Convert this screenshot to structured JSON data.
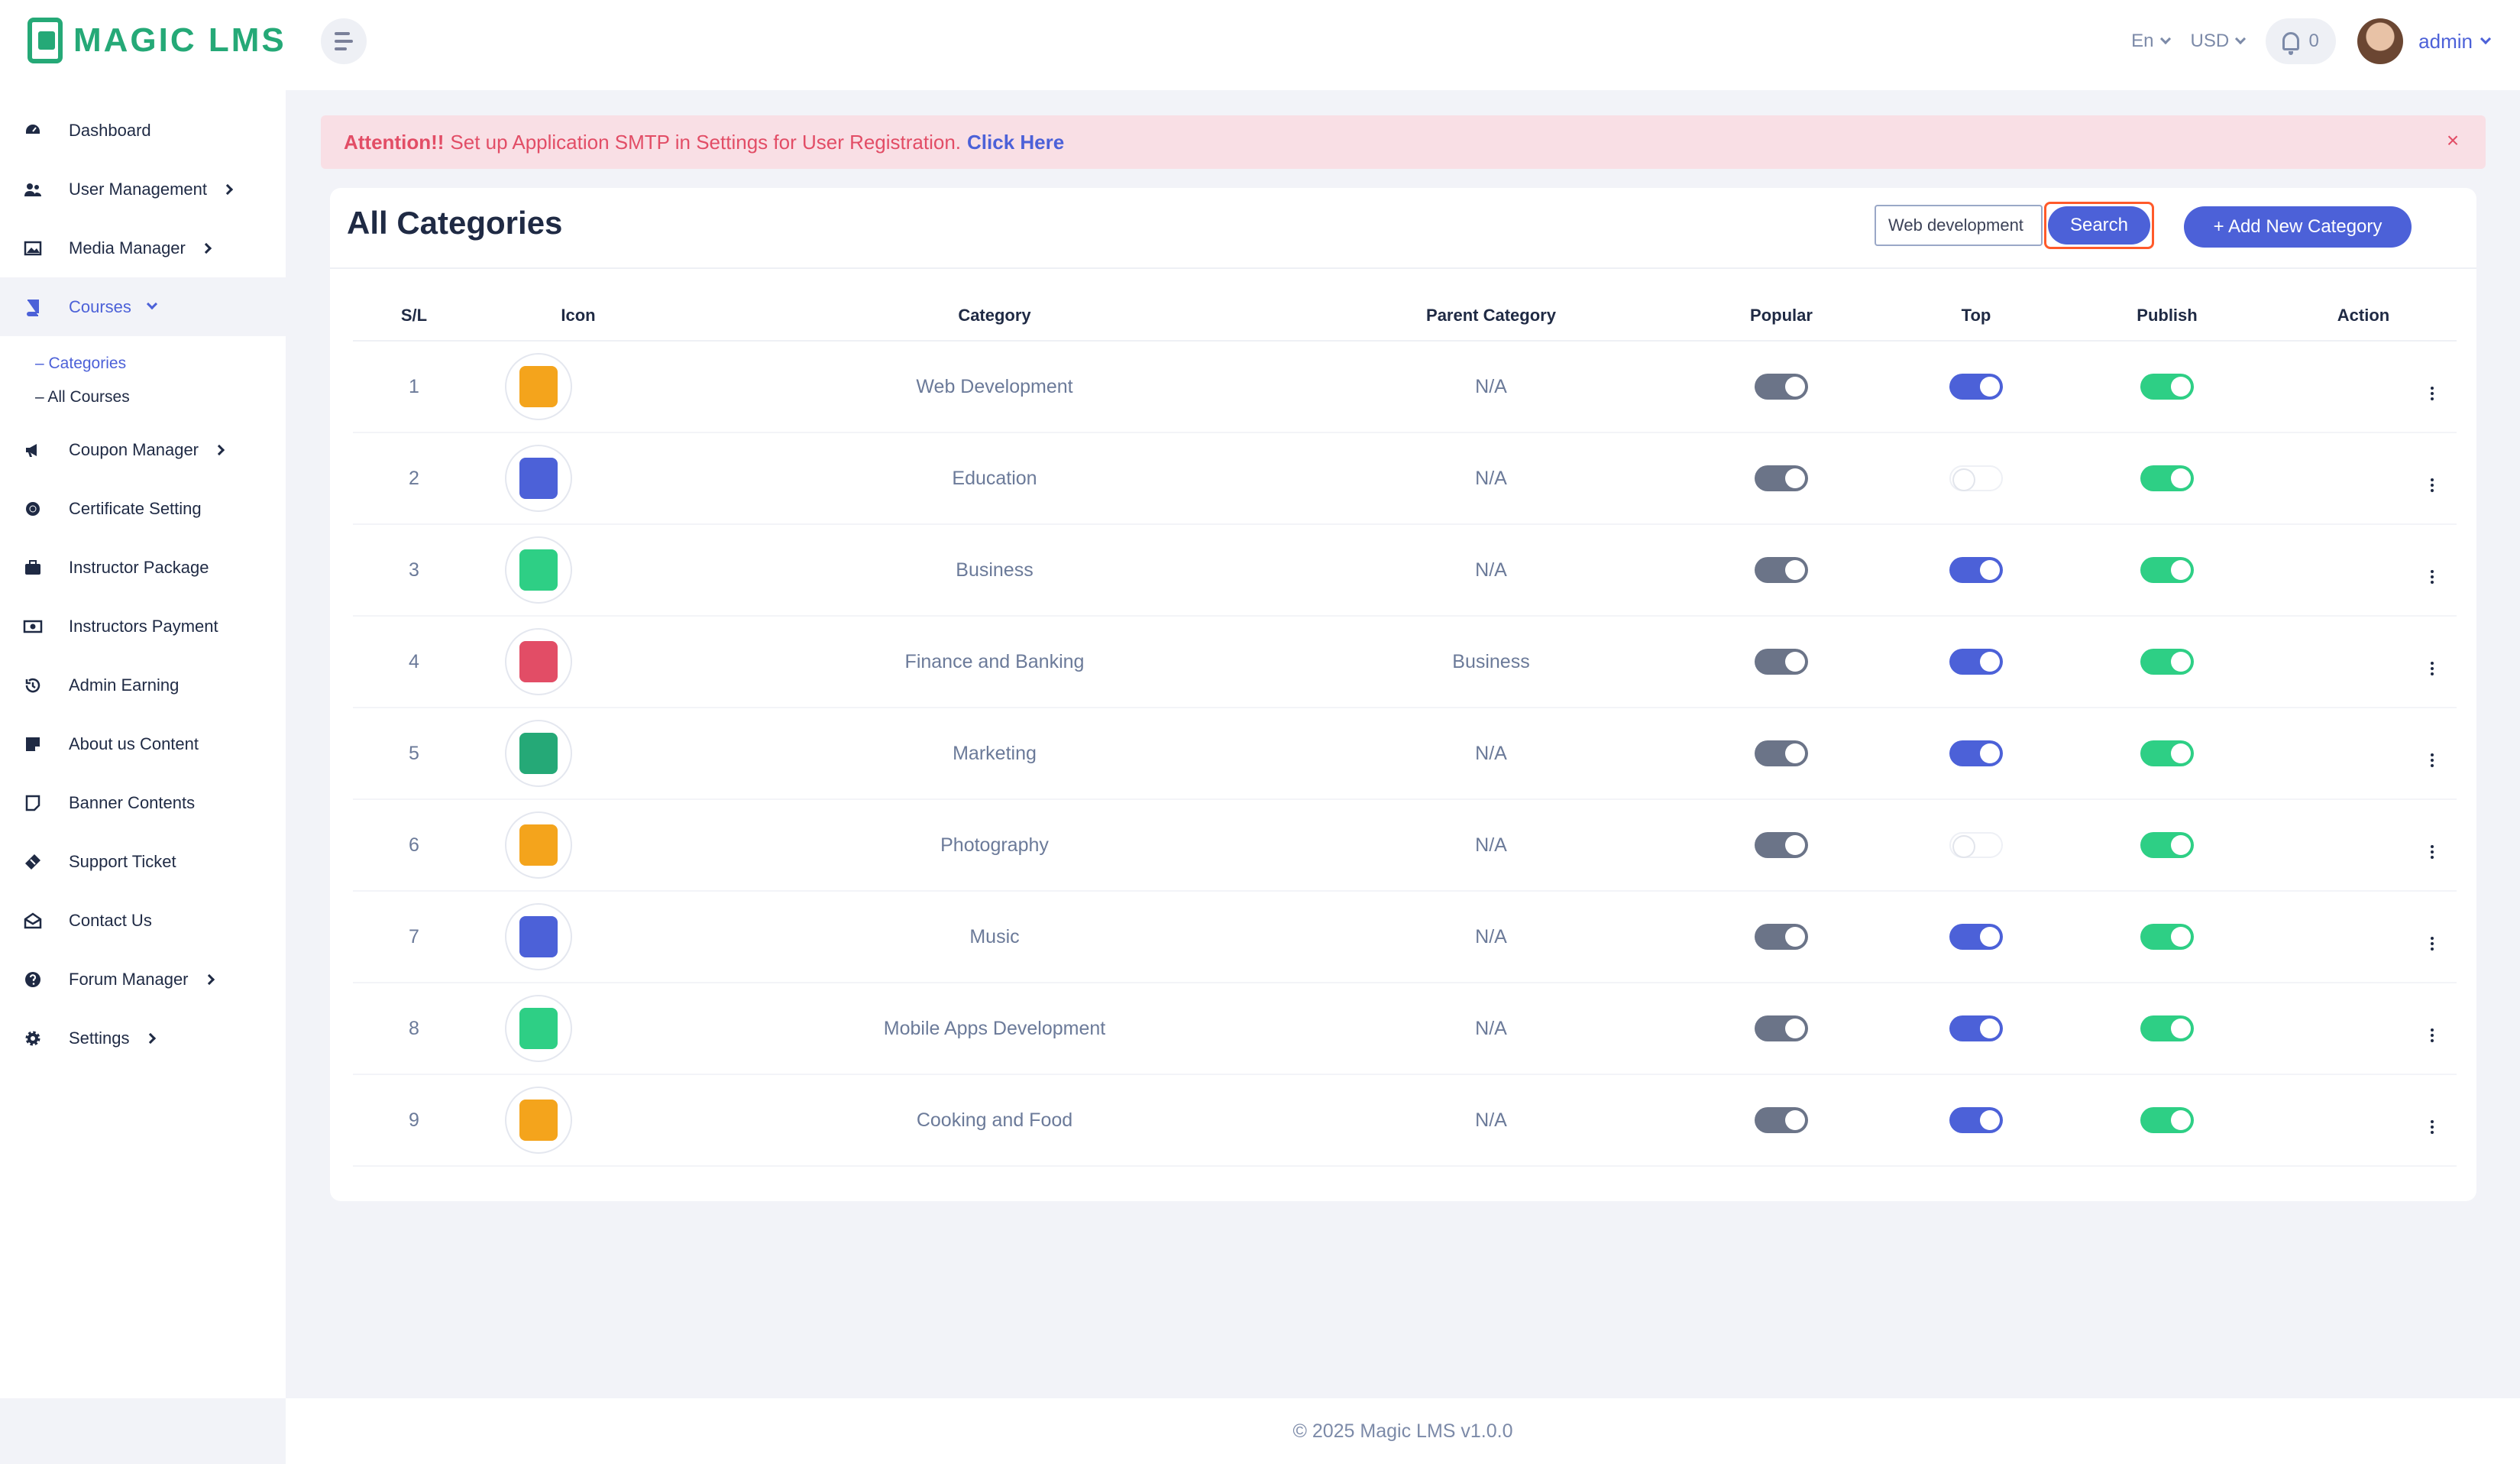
{
  "brand": {
    "name": "MAGIC LMS",
    "color": "#25a977"
  },
  "header": {
    "language": "En",
    "currency": "USD",
    "notification_count": "0",
    "user": "admin"
  },
  "sidebar": {
    "items": [
      {
        "label": "Dashboard",
        "icon": "dashboard-icon"
      },
      {
        "label": "User Management",
        "icon": "users-icon"
      },
      {
        "label": "Media Manager",
        "icon": "image-icon"
      },
      {
        "label": "Courses",
        "icon": "book-icon"
      },
      {
        "label": "Coupon Manager",
        "icon": "megaphone-icon"
      },
      {
        "label": "Certificate Setting",
        "icon": "certificate-icon"
      },
      {
        "label": "Instructor Package",
        "icon": "briefcase-icon"
      },
      {
        "label": "Instructors Payment",
        "icon": "money-icon"
      },
      {
        "label": "Admin Earning",
        "icon": "history-icon"
      },
      {
        "label": "About us Content",
        "icon": "note-icon"
      },
      {
        "label": "Banner Contents",
        "icon": "banner-icon"
      },
      {
        "label": "Support Ticket",
        "icon": "ticket-icon"
      },
      {
        "label": "Contact Us",
        "icon": "envelope-icon"
      },
      {
        "label": "Forum Manager",
        "icon": "question-icon"
      },
      {
        "label": "Settings",
        "icon": "gear-icon"
      }
    ],
    "courses_sub": [
      "– Categories",
      "– All Courses"
    ]
  },
  "alert": {
    "prefix": "Attention!!",
    "message": "Set up Application SMTP in Settings for User Registration.",
    "link": "Click Here"
  },
  "page": {
    "title": "All Categories",
    "search_value": "Web development",
    "search_label": "Search",
    "add_label": "+ Add New Category"
  },
  "table": {
    "headers": [
      "S/L",
      "Icon",
      "Category",
      "Parent Category",
      "Popular",
      "Top",
      "Publish",
      "Action"
    ],
    "rows": [
      {
        "sl": "1",
        "category": "Web Development",
        "parent": "N/A",
        "popular": true,
        "top": true,
        "publish": true
      },
      {
        "sl": "2",
        "category": "Education",
        "parent": "N/A",
        "popular": true,
        "top": false,
        "publish": true
      },
      {
        "sl": "3",
        "category": "Business",
        "parent": "N/A",
        "popular": true,
        "top": true,
        "publish": true
      },
      {
        "sl": "4",
        "category": "Finance and Banking",
        "parent": "Business",
        "popular": true,
        "top": true,
        "publish": true
      },
      {
        "sl": "5",
        "category": "Marketing",
        "parent": "N/A",
        "popular": true,
        "top": true,
        "publish": true
      },
      {
        "sl": "6",
        "category": "Photography",
        "parent": "N/A",
        "popular": true,
        "top": false,
        "publish": true
      },
      {
        "sl": "7",
        "category": "Music",
        "parent": "N/A",
        "popular": true,
        "top": true,
        "publish": true
      },
      {
        "sl": "8",
        "category": "Mobile Apps Development",
        "parent": "N/A",
        "popular": true,
        "top": true,
        "publish": true
      },
      {
        "sl": "9",
        "category": "Cooking and Food",
        "parent": "N/A",
        "popular": true,
        "top": true,
        "publish": true
      }
    ]
  },
  "footer": "© 2025 Magic LMS v1.0.0"
}
